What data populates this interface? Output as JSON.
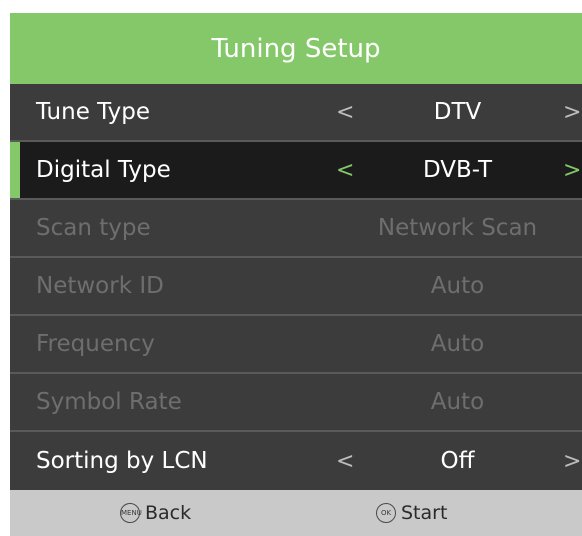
{
  "title": "Tuning Setup",
  "rows": [
    {
      "label": "Tune Type",
      "value": "DTV",
      "arrow_left": "<",
      "arrow_right": ">"
    },
    {
      "label": "Digital Type",
      "value": "DVB-T",
      "arrow_left": "<",
      "arrow_right": ">"
    },
    {
      "label": "Scan type",
      "value": "Network Scan"
    },
    {
      "label": "Network ID",
      "value": "Auto"
    },
    {
      "label": "Frequency",
      "value": "Auto"
    },
    {
      "label": "Symbol Rate",
      "value": "Auto"
    },
    {
      "label": "Sorting by LCN",
      "value": "Off",
      "arrow_left": "<",
      "arrow_right": ">"
    }
  ],
  "footer": {
    "back_icon_text": "MENU",
    "back_label": "Back",
    "start_icon_text": "OK",
    "start_label": "Start"
  },
  "colors": {
    "accent": "#84c86a",
    "row_bg": "#3c3c3c",
    "selected_bg": "#1b1b1b",
    "disabled_text": "#6e6e6e",
    "footer_bg": "#c9c9c9"
  }
}
